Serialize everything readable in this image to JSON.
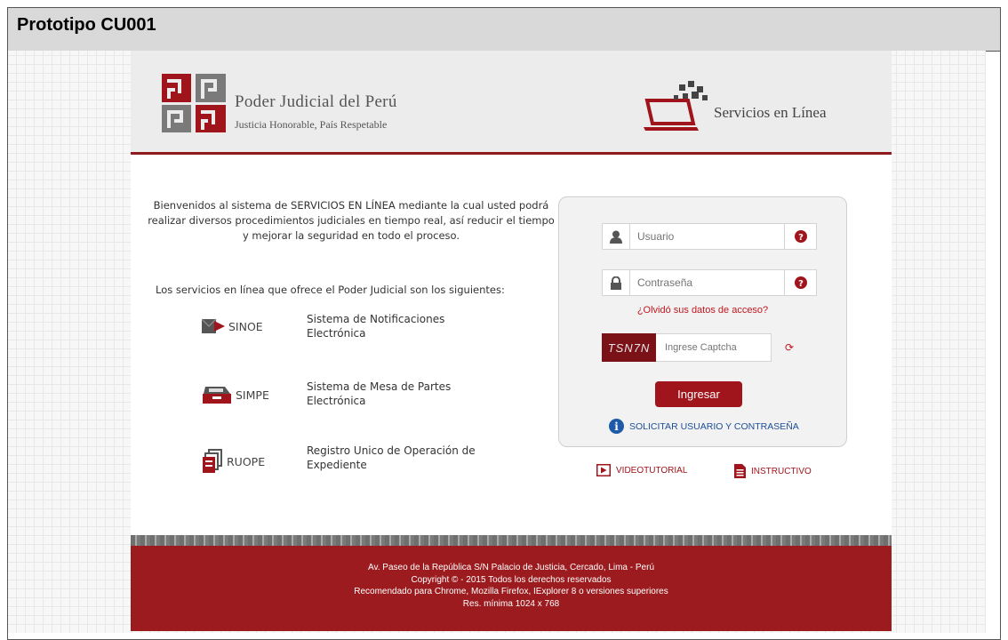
{
  "prototype_title": "Prototipo CU001",
  "header": {
    "org_name": "Poder Judicial del Perú",
    "org_tagline": "Justicia Honorable, País Respetable",
    "services_title": "Servicios en Línea"
  },
  "intro": {
    "welcome_text": "Bienvenidos al sistema de  SERVICIOS EN LÍNEA mediante la cual usted podrá realizar diversos procedimientos judiciales en tiempo real, así reducir el tiempo y mejorar la seguridad en todo el proceso.",
    "services_heading": "Los servicios en línea que ofrece el Poder Judicial son los siguientes:"
  },
  "services": [
    {
      "abbr": "SINOE",
      "line1": "Sistema de Notificaciones",
      "line2": "Electrónica",
      "icon": "envelope-icon"
    },
    {
      "abbr": "SIMPE",
      "line1": "Sistema de Mesa de Partes",
      "line2": "Electrónica",
      "icon": "inbox-tray-icon"
    },
    {
      "abbr": "RUOPE",
      "line1": "Registro Unico de Operación de",
      "line2": "Expediente",
      "icon": "documents-icon"
    }
  ],
  "login": {
    "username_placeholder": "Usuario",
    "password_placeholder": "Contraseña",
    "forgot_link": "¿Olvidó sus datos de acceso?",
    "captcha_text": "TSN7N",
    "captcha_placeholder": "Ingrese Captcha",
    "submit_label": "Ingresar",
    "request_link": "SOLICITAR USUARIO Y CONTRASEÑA"
  },
  "media": {
    "video_label": "VIDEOTUTORIAL",
    "instructions_label": "INSTRUCTIVO"
  },
  "footer": {
    "address": "Av. Paseo de la República S/N Palacio de Justicia, Cercado, Lima - Perú",
    "copyright": "Copyright © - 2015 Todos los derechos reservados",
    "browsers": "Recomendado para Chrome, Mozilla Firefox, IExplorer 8 o versiones superiores",
    "resolution": "Res. mínima 1024 x 768"
  },
  "colors": {
    "brand_red": "#a0141b",
    "dark_red": "#8e1a1e",
    "link_blue": "#1d4e9b"
  }
}
